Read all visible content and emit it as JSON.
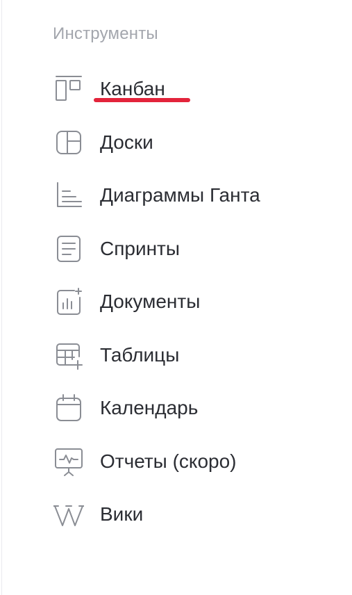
{
  "panel": {
    "title": "Инструменты",
    "accent_color": "#e3243b",
    "items": [
      {
        "label": "Канбан",
        "icon": "kanban-icon",
        "active": true
      },
      {
        "label": "Доски",
        "icon": "boards-icon",
        "active": false
      },
      {
        "label": "Диаграммы Ганта",
        "icon": "gantt-icon",
        "active": false
      },
      {
        "label": "Спринты",
        "icon": "sprint-icon",
        "active": false
      },
      {
        "label": "Документы",
        "icon": "documents-icon",
        "active": false
      },
      {
        "label": "Таблицы",
        "icon": "table-icon",
        "active": false
      },
      {
        "label": "Календарь",
        "icon": "calendar-icon",
        "active": false
      },
      {
        "label": "Отчеты (скоро)",
        "icon": "reports-icon",
        "active": false
      },
      {
        "label": "Вики",
        "icon": "wiki-icon",
        "active": false
      }
    ]
  }
}
